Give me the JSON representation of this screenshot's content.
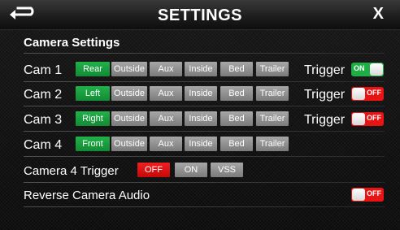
{
  "header": {
    "title": "SETTINGS",
    "close_label": "X"
  },
  "section_title": "Camera Settings",
  "position_options": [
    "Outside",
    "Aux",
    "Inside",
    "Bed",
    "Trailer"
  ],
  "cameras": [
    {
      "label": "Cam 1",
      "selected": "Rear",
      "trigger_label": "Trigger",
      "trigger_state": "ON"
    },
    {
      "label": "Cam 2",
      "selected": "Left",
      "trigger_label": "Trigger",
      "trigger_state": "OFF"
    },
    {
      "label": "Cam 3",
      "selected": "Right",
      "trigger_label": "Trigger",
      "trigger_state": "OFF"
    },
    {
      "label": "Cam 4",
      "selected": "Front"
    }
  ],
  "camera4_trigger": {
    "label": "Camera 4 Trigger",
    "options": [
      "OFF",
      "ON",
      "VSS"
    ],
    "selected": "OFF"
  },
  "reverse_audio": {
    "label": "Reverse Camera Audio",
    "state": "OFF"
  },
  "colors": {
    "selected_green": "#138a34",
    "off_red": "#e81414",
    "on_green": "#1fae45",
    "unselected_gray": "#8e8e8e"
  }
}
